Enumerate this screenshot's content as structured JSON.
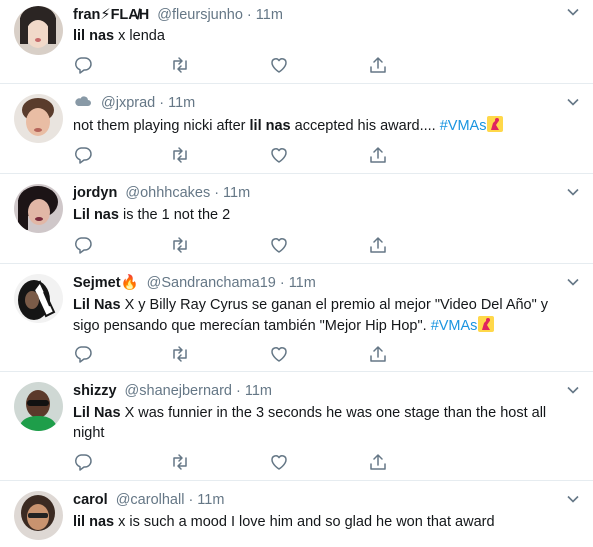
{
  "tweets": [
    {
      "name": "fran⚡FLA̸H",
      "handle": "@fleursjunho",
      "time": "11m",
      "segments": [
        {
          "text": "lil nas",
          "bold": true
        },
        {
          "text": " x lenda"
        }
      ]
    },
    {
      "name": "",
      "name_icon": "cloud-icon",
      "handle": "@jxprad",
      "time": "11m",
      "segments": [
        {
          "text": "not them playing nicki after "
        },
        {
          "text": "lil nas",
          "bold": true
        },
        {
          "text": " accepted his award.... "
        },
        {
          "text": "#VMAs",
          "hashtag": true
        }
      ],
      "trailing_icon": "vma-moonman-icon"
    },
    {
      "name": "jordyn",
      "handle": "@ohhhcakes",
      "time": "11m",
      "segments": [
        {
          "text": "Lil nas",
          "bold": true
        },
        {
          "text": " is the 1 not the 2"
        }
      ]
    },
    {
      "name": "Sejmet🔥",
      "handle": "@Sandranchama19",
      "time": "11m",
      "segments": [
        {
          "text": "Lil Nas",
          "bold": true
        },
        {
          "text": " X y Billy Ray Cyrus se ganan el premio al mejor \"Video Del Año\" y sigo pensando que merecían también \"Mejor Hip Hop\". "
        },
        {
          "text": "#VMAs",
          "hashtag": true
        }
      ],
      "trailing_icon": "vma-moonman-icon"
    },
    {
      "name": "shizzy",
      "handle": "@shanejbernard",
      "time": "11m",
      "segments": [
        {
          "text": "Lil Nas",
          "bold": true
        },
        {
          "text": " X was funnier in the 3 seconds he was one stage than the host all night"
        }
      ]
    },
    {
      "name": "carol",
      "handle": "@carolhall",
      "time": "11m",
      "segments": [
        {
          "text": "lil nas",
          "bold": true
        },
        {
          "text": " x is such a mood I love him and so glad he won that award"
        }
      ]
    }
  ],
  "icons": {
    "reply": "reply-icon",
    "retweet": "retweet-icon",
    "like": "heart-icon",
    "share": "share-icon",
    "menu": "chevron-down-icon"
  },
  "colors": {
    "hashtag": "#1b95e0",
    "muted": "#657786",
    "divider": "#e6ecf0"
  }
}
